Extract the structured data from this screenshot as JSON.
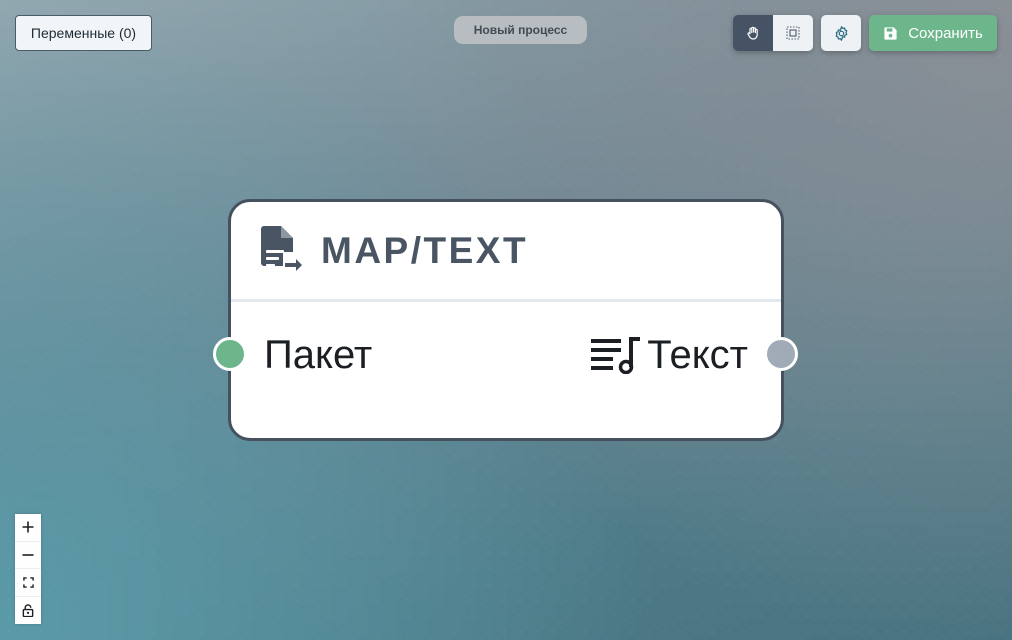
{
  "toolbar": {
    "variables_label": "Переменные (0)",
    "process_name": "Новый процесс",
    "pan_mode_icon": "hand-icon",
    "select_mode_icon": "selection-box-icon",
    "settings_icon": "gear-settings-icon",
    "save_icon": "floppy-disk-icon",
    "save_label": "Сохранить"
  },
  "node": {
    "icon": "document-export-icon",
    "title": "MAP/TEXT",
    "input_port": {
      "label": "Пакет",
      "color": "#6db68b"
    },
    "output_port": {
      "label": "Текст",
      "icon": "music-list-icon",
      "color": "#a0abb7"
    }
  },
  "zoom_controls": {
    "items": [
      "zoom-in-icon",
      "zoom-out-icon",
      "fit-view-icon",
      "lock-icon"
    ]
  },
  "colors": {
    "accent_green": "#6db68b",
    "node_border": "#46515f",
    "active_mode": "#455365"
  }
}
